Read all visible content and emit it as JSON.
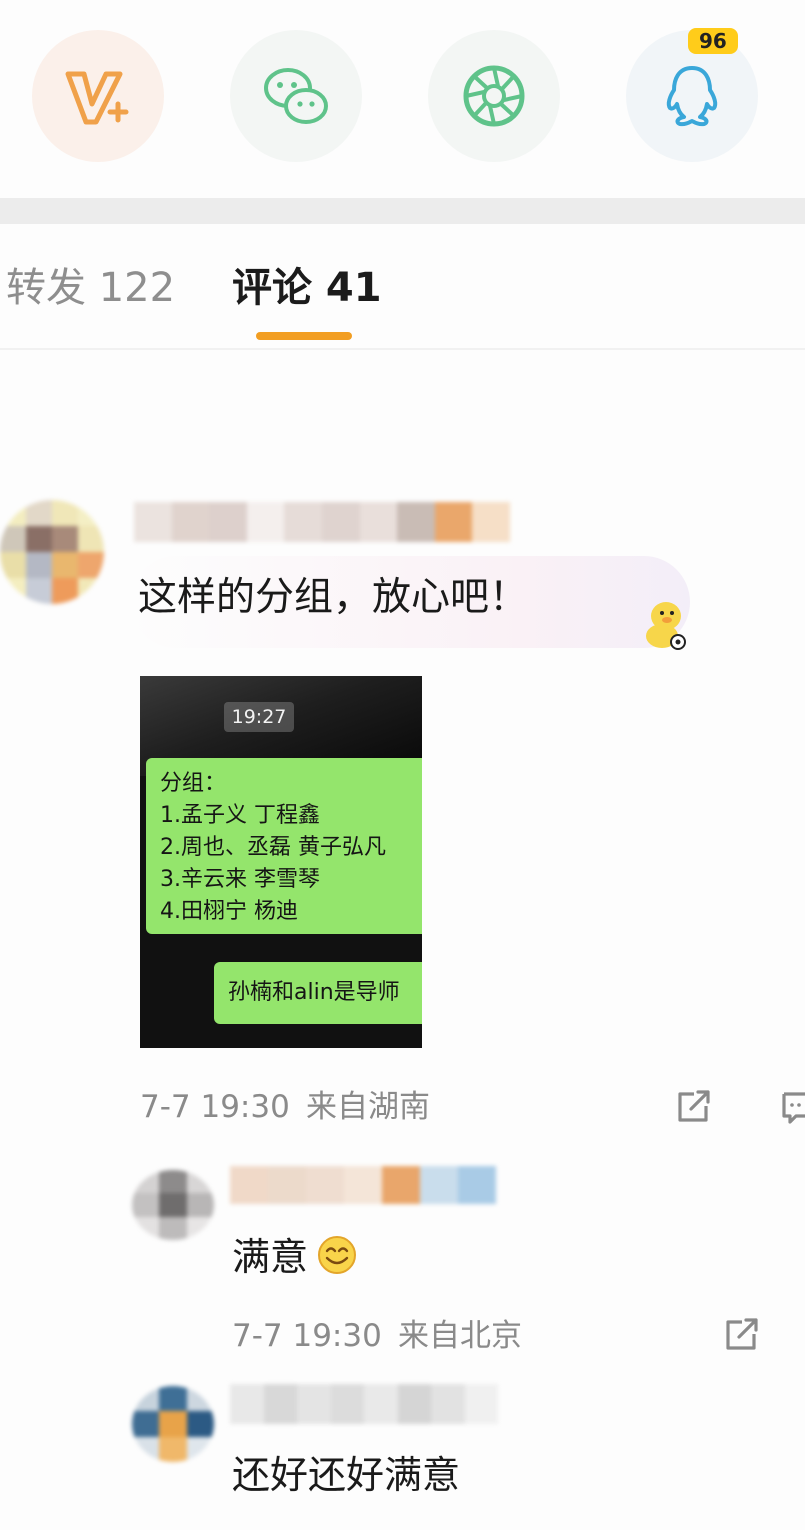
{
  "share": {
    "icons": [
      "vip-plus-icon",
      "wechat-icon",
      "moments-icon",
      "qq-icon"
    ],
    "qq_badge": "96",
    "colors": {
      "vip": "#f0a14a",
      "wechat": "#5fc38a",
      "moments": "#5fc38a",
      "qq": "#3aa7d9"
    }
  },
  "tabs": {
    "repost": "转发 122",
    "comment": "评论 41",
    "active_color": "#f29e22"
  },
  "comment": {
    "text": "这样的分组，放心吧！",
    "sticker": "duck-sticker-icon",
    "attached_image": {
      "time": "19:27",
      "lines": [
        "分组：",
        "1.孟子义 丁程鑫",
        "2.周也、丞磊  黄子弘凡",
        "3.辛云来 李雪琴",
        "4.田栩宁 杨迪"
      ],
      "reply": "孙楠和alin是导师"
    },
    "date": "7-7 19:30",
    "location": "来自湖南"
  },
  "replies": [
    {
      "text": "满意",
      "emoji": "smile-emoji-icon",
      "date": "7-7 19:30",
      "location": "来自北京"
    },
    {
      "text": "还好还好满意"
    }
  ]
}
